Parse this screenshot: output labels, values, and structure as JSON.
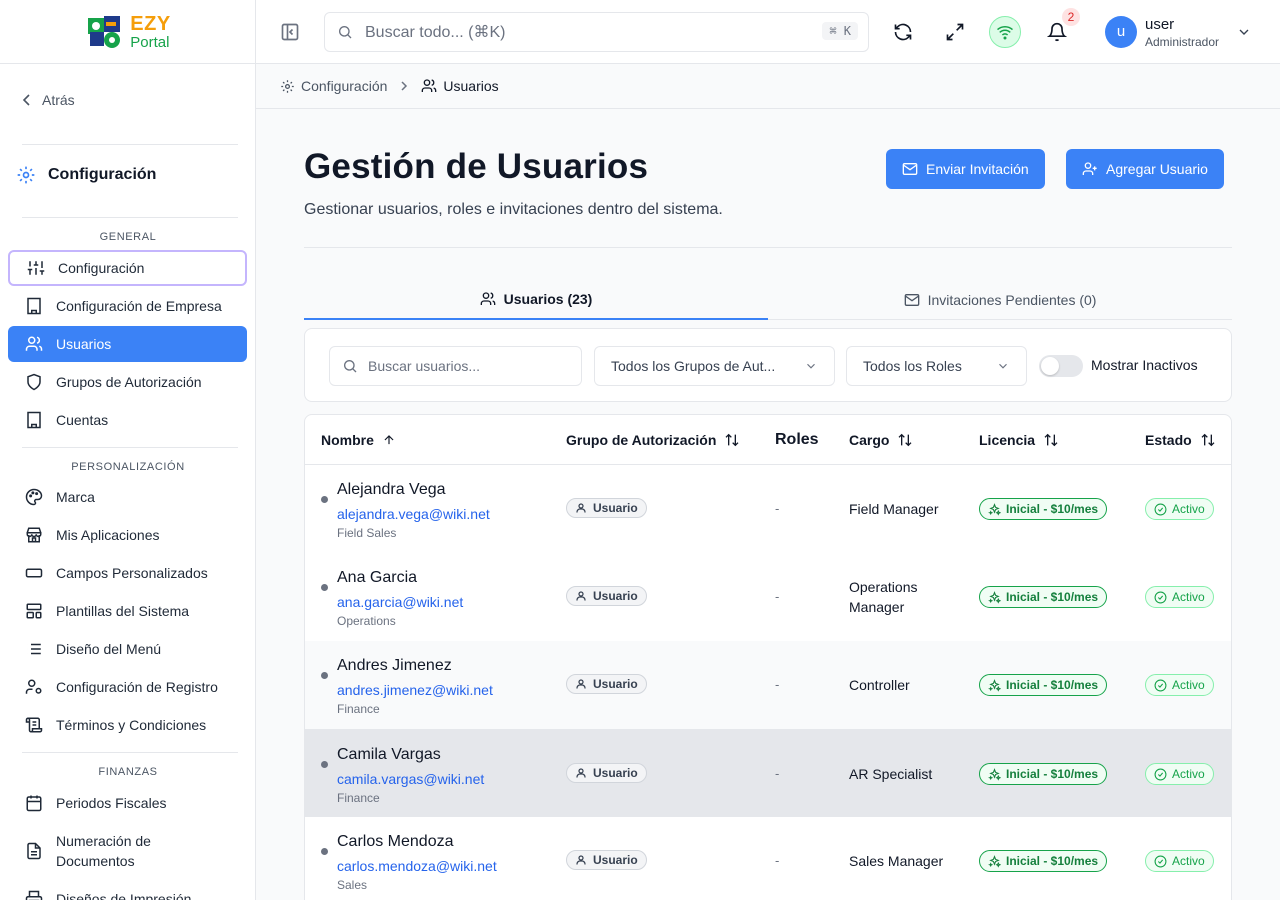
{
  "app": {
    "logo_line1": "EZY",
    "logo_line2": "Portal"
  },
  "sidebar": {
    "back_label": "Atrás",
    "section_title": "Configuración",
    "groups": [
      {
        "label": "GENERAL",
        "items": [
          {
            "label": "Configuración",
            "icon": "sliders-icon",
            "state": "focused"
          },
          {
            "label": "Configuración de Empresa",
            "icon": "building-icon"
          },
          {
            "label": "Usuarios",
            "icon": "users-icon",
            "state": "active"
          },
          {
            "label": "Grupos de Autorización",
            "icon": "shield-icon"
          },
          {
            "label": "Cuentas",
            "icon": "building-icon"
          }
        ]
      },
      {
        "label": "PERSONALIZACIÓN",
        "items": [
          {
            "label": "Marca",
            "icon": "palette-icon"
          },
          {
            "label": "Mis Aplicaciones",
            "icon": "store-icon"
          },
          {
            "label": "Campos Personalizados",
            "icon": "input-icon"
          },
          {
            "label": "Plantillas del Sistema",
            "icon": "layout-icon"
          },
          {
            "label": "Diseño del Menú",
            "icon": "list-icon"
          },
          {
            "label": "Configuración de Registro",
            "icon": "user-cog-icon"
          },
          {
            "label": "Términos y Condiciones",
            "icon": "scroll-icon"
          }
        ]
      },
      {
        "label": "FINANZAS",
        "items": [
          {
            "label": "Periodos Fiscales",
            "icon": "calendar-icon"
          },
          {
            "label": "Numeración de Documentos",
            "icon": "file-text-icon"
          },
          {
            "label": "Diseños de Impresión",
            "icon": "printer-icon"
          }
        ]
      }
    ]
  },
  "header": {
    "search_placeholder": "Buscar todo... (⌘K)",
    "search_shortcut": "⌘ K",
    "notification_count": "2",
    "user_initial": "u",
    "user_name": "user",
    "user_role": "Administrador"
  },
  "breadcrumb": {
    "parent": "Configuración",
    "current": "Usuarios"
  },
  "page": {
    "title": "Gestión de Usuarios",
    "subtitle": "Gestionar usuarios, roles e invitaciones dentro del sistema.",
    "invite_button": "Enviar Invitación",
    "add_button": "Agregar Usuario"
  },
  "tabs": {
    "users": "Usuarios (23)",
    "invitations": "Invitaciones Pendientes (0)"
  },
  "filters": {
    "search_placeholder": "Buscar usuarios...",
    "auth_group_select": "Todos los Grupos de Aut...",
    "roles_select": "Todos los Roles",
    "show_inactive_label": "Mostrar Inactivos",
    "show_inactive_on": false
  },
  "table": {
    "columns": {
      "name": "Nombre",
      "auth_group": "Grupo de Autorización",
      "roles": "Roles",
      "cargo": "Cargo",
      "license": "Licencia",
      "status": "Estado"
    },
    "rows": [
      {
        "name": "Alejandra Vega",
        "email": "alejandra.vega@wiki.net",
        "dept": "Field Sales",
        "group": "Usuario",
        "roles": "-",
        "cargo": "Field Manager",
        "license": "Inicial - $10/mes",
        "status": "Activo"
      },
      {
        "name": "Ana Garcia",
        "email": "ana.garcia@wiki.net",
        "dept": "Operations",
        "group": "Usuario",
        "roles": "-",
        "cargo": "Operations Manager",
        "license": "Inicial - $10/mes",
        "status": "Activo"
      },
      {
        "name": "Andres Jimenez",
        "email": "andres.jimenez@wiki.net",
        "dept": "Finance",
        "group": "Usuario",
        "roles": "-",
        "cargo": "Controller",
        "license": "Inicial - $10/mes",
        "status": "Activo"
      },
      {
        "name": "Camila Vargas",
        "email": "camila.vargas@wiki.net",
        "dept": "Finance",
        "group": "Usuario",
        "roles": "-",
        "cargo": "AR Specialist",
        "license": "Inicial - $10/mes",
        "status": "Activo"
      },
      {
        "name": "Carlos Mendoza",
        "email": "carlos.mendoza@wiki.net",
        "dept": "Sales",
        "group": "Usuario",
        "roles": "-",
        "cargo": "Sales Manager",
        "license": "Inicial - $10/mes",
        "status": "Activo"
      }
    ]
  },
  "colors": {
    "primary": "#3b82f6",
    "success": "#16a34a",
    "logo_orange": "#f59e0b",
    "logo_green": "#16a34a",
    "badge_red": "#dc2626"
  }
}
